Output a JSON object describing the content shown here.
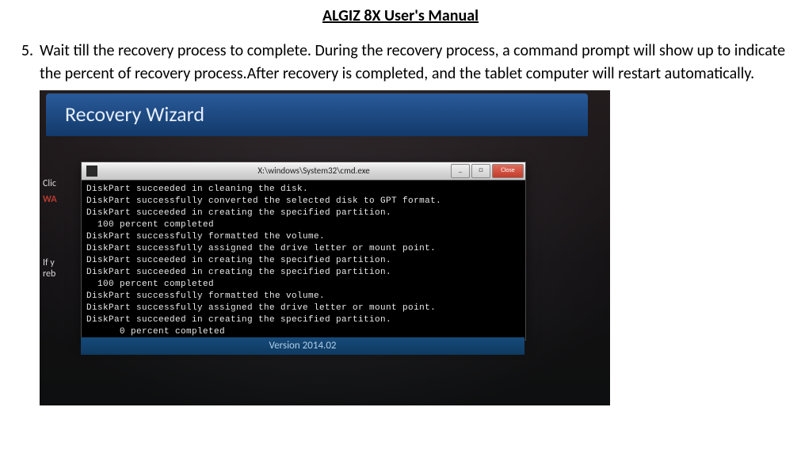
{
  "doc": {
    "title": "ALGIZ 8X User's Manual",
    "step_number": "5.",
    "step_text": "Wait till the recovery process to complete. During the recovery process, a command prompt will show up to indicate the percent of recovery process.After recovery is completed, and the tablet computer will restart automatically."
  },
  "wizard": {
    "title": "Recovery Wizard",
    "version_label": "Version 2014.02"
  },
  "bg": {
    "click": "Clic",
    "warn": "WA",
    "ify": "If y",
    "reb": "reb"
  },
  "cmd": {
    "title_path": "X:\\windows\\System32\\cmd.exe",
    "close_label": "Close",
    "lines": [
      "DiskPart succeeded in cleaning the disk.",
      "DiskPart successfully converted the selected disk to GPT format.",
      "DiskPart succeeded in creating the specified partition.",
      "  100 percent completed",
      "DiskPart successfully formatted the volume.",
      "DiskPart successfully assigned the drive letter or mount point.",
      "DiskPart succeeded in creating the specified partition.",
      "DiskPart succeeded in creating the specified partition.",
      "  100 percent completed",
      "DiskPart successfully formatted the volume.",
      "DiskPart successfully assigned the drive letter or mount point.",
      "DiskPart succeeded in creating the specified partition.",
      "      0 percent completed"
    ]
  }
}
